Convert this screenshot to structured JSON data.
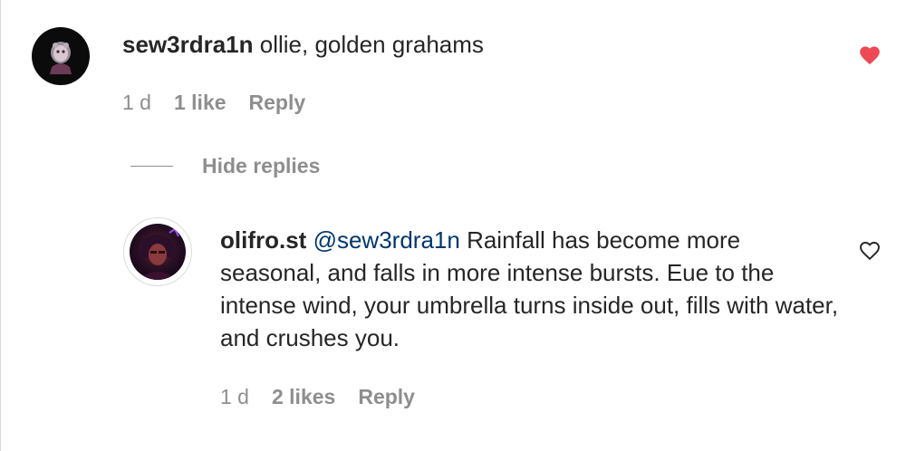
{
  "colors": {
    "liked_heart": "#ed4956",
    "mention": "#00376b",
    "secondary_text": "#8e8e8e",
    "primary_text": "#262626"
  },
  "comment": {
    "username": "sew3rdra1n",
    "text": "ollie, golden grahams",
    "time": "1 d",
    "likes": "1 like",
    "reply": "Reply",
    "liked": true,
    "like_icon": "heart-filled-icon"
  },
  "replies_toggle": {
    "label": "Hide replies"
  },
  "reply_comment": {
    "username": "olifro.st",
    "mention": "@sew3rdra1n",
    "text": "Rainfall has become more seasonal, and falls in more intense bursts. Eue to the intense wind, your umbrella turns inside out, fills with water, and crushes you.",
    "time": "1 d",
    "likes": "2 likes",
    "reply": "Reply",
    "liked": false,
    "like_icon": "heart-outline-icon"
  }
}
